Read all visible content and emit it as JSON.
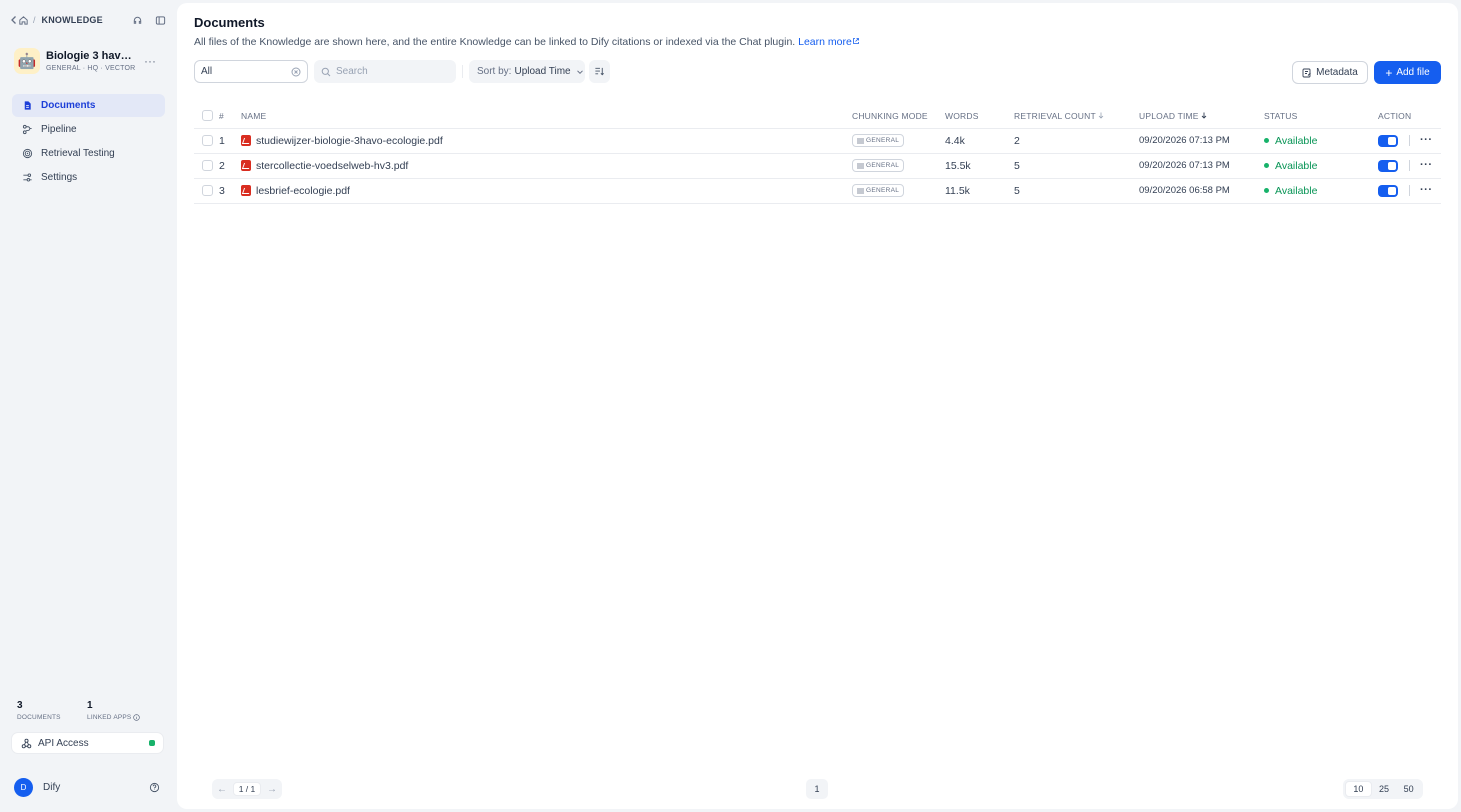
{
  "nav": {
    "crumb": "KNOWLEDGE"
  },
  "kb": {
    "name": "Biologie 3 havo...",
    "tags": "GENERAL · HQ · VECTOR",
    "avatar": "🤖"
  },
  "sidebar": {
    "items": [
      {
        "label": "Documents",
        "icon": "document-icon",
        "active": true
      },
      {
        "label": "Pipeline",
        "icon": "pipeline-icon",
        "active": false
      },
      {
        "label": "Retrieval Testing",
        "icon": "target-icon",
        "active": false
      },
      {
        "label": "Settings",
        "icon": "settings-icon",
        "active": false
      }
    ],
    "stats": [
      {
        "value": "3",
        "label": "DOCUMENTS"
      },
      {
        "value": "1",
        "label": "LINKED APPS"
      }
    ],
    "api_label": "API Access",
    "user_initial": "D",
    "user_name": "Dify"
  },
  "main": {
    "title": "Documents",
    "description": "All files of the Knowledge are shown here, and the entire Knowledge can be linked to Dify citations or indexed via the Chat plugin.",
    "learn_more": "Learn more",
    "filter_value": "All",
    "search_placeholder": "Search",
    "sort_prefix": "Sort by:",
    "sort_value": "Upload Time",
    "metadata_label": "Metadata",
    "add_file_label": "Add file"
  },
  "table": {
    "headers": {
      "index": "#",
      "name": "NAME",
      "chunking": "CHUNKING MODE",
      "words": "WORDS",
      "retrieval": "RETRIEVAL COUNT",
      "upload": "UPLOAD TIME",
      "status": "STATUS",
      "action": "ACTION"
    },
    "rows": [
      {
        "index": "1",
        "name": "studiewijzer-biologie-3havo-ecologie.pdf",
        "chunking": "GENERAL",
        "words": "4.4k",
        "retrieval": "2",
        "upload": "09/20/2026 07:13 PM",
        "status": "Available"
      },
      {
        "index": "2",
        "name": "stercollectie-voedselweb-hv3.pdf",
        "chunking": "GENERAL",
        "words": "15.5k",
        "retrieval": "5",
        "upload": "09/20/2026 07:13 PM",
        "status": "Available"
      },
      {
        "index": "3",
        "name": "lesbrief-ecologie.pdf",
        "chunking": "GENERAL",
        "words": "11.5k",
        "retrieval": "5",
        "upload": "09/20/2026 06:58 PM",
        "status": "Available"
      }
    ]
  },
  "pagination": {
    "page_indicator": "1 / 1",
    "current_page": "1",
    "sizes": [
      "10",
      "25",
      "50"
    ],
    "selected_size": "10"
  },
  "colors": {
    "accent": "#155eef",
    "available": "#17b26a",
    "pdf": "#d92d20"
  }
}
